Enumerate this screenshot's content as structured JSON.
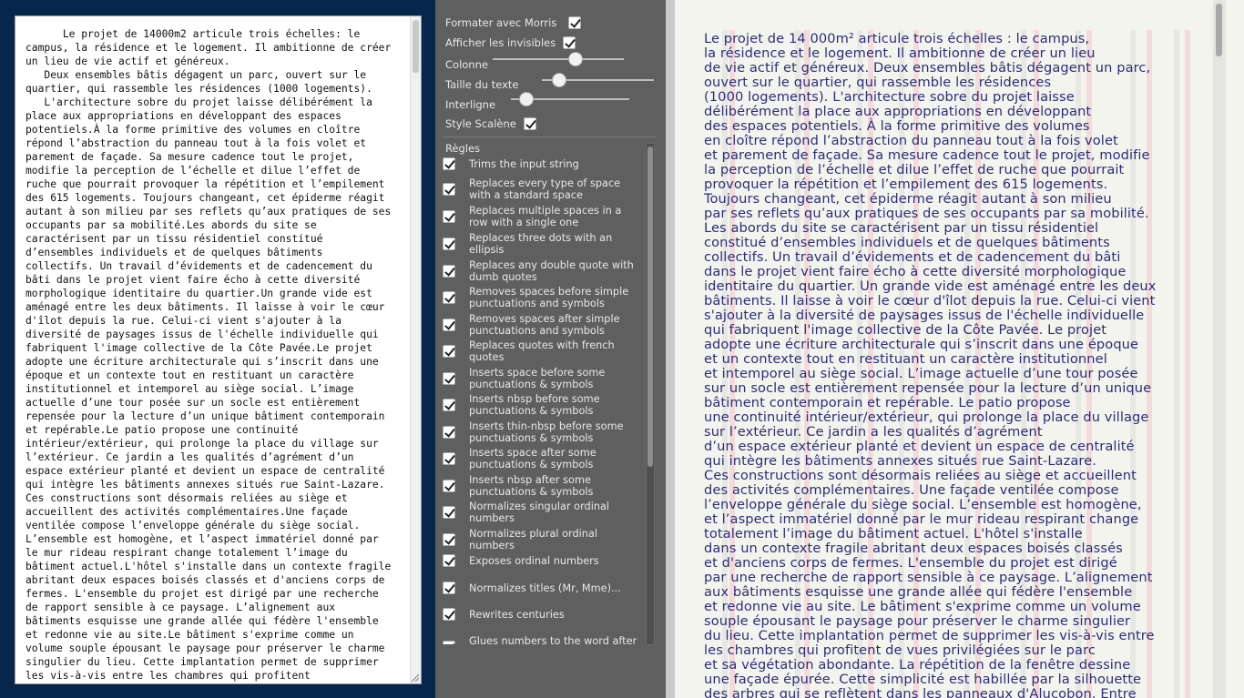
{
  "source_text": "      Le projet de 14000m2 articule trois échelles: le campus, la résidence et le logement. Il ambitionne de créer un lieu de vie actif et généreux.\n   Deux ensembles bâtis dégagent un parc, ouvert sur le quartier, qui rassemble les résidences (1000 logements).\n   L'architecture sobre du projet laisse délibérément la place aux appropriations en développant des espaces potentiels.À la forme primitive des volumes en cloître répond l’abstraction du panneau tout à la fois volet et parement de façade. Sa mesure cadence tout le projet, modifie la perception de l’échelle et dilue l’effet de ruche que pourrait provoquer la répétition et l’empilement des 615 logements. Toujours changeant, cet épiderme réagit autant à son milieu par ses reflets qu’aux pratiques de ses occupants par sa mobilité.Les abords du site se caractérisent par un tissu résidentiel constitué d’ensembles individuels et de quelques bâtiments collectifs. Un travail d’évidements et de cadencement du bâti dans le projet vient faire écho à cette diversité morphologique identitaire du quartier.Un grande vide est aménagé entre les deux bâtiments. Il laisse à voir le cœur d'îlot depuis la rue. Celui-ci vient s'ajouter à la diversité de paysages issus de l'échelle individuelle qui fabriquent l'image collective de la Côte Pavée.Le projet adopte une écriture architecturale qui s’inscrit dans une époque et un contexte tout en restituant un caractère institutionnel et intemporel au siège social. L’image actuelle d’une tour posée sur un socle est entièrement repensée pour la lecture d’un unique bâtiment contemporain et repérable.Le patio propose une continuité intérieur/extérieur, qui prolonge la place du village sur l’extérieur. Ce jardin a les qualités d’agrément d’un espace extérieur planté et devient un espace de centralité qui intègre les bâtiments annexes situés rue Saint-Lazare. Ces constructions sont désormais reliées au siège et accueillent des activités complémentaires.Une façade ventilée compose l’enveloppe générale du siège social. L’ensemble est homogène, et l’aspect immatériel donné par le mur rideau respirant change totalement l’image du bâtiment actuel.L'hôtel s'installe dans un contexte fragile abritant deux espaces boisés classés et d'anciens corps de fermes. L'ensemble du projet est dirigé par une recherche de rapport sensible à ce paysage. L’alignement aux bâtiments esquisse une grande allée qui fédère l'ensemble et redonne vie au site.Le bâtiment s'exprime comme un volume souple épousant le paysage pour préserver le charme singulier du lieu. Cette implantation permet de supprimer les vis-à-vis entre les chambres qui profitent",
  "options": {
    "morris_label": "Formater avec Morris",
    "morris_checked": true,
    "invisibles_label": "Afficher les invisibles",
    "invisibles_checked": true,
    "column_label": "Colonne",
    "column_value": 0.65,
    "text_size_label": "Taille du texte",
    "text_size_value": 0.1,
    "line_height_label": "Interligne",
    "line_height_value": 0.08,
    "scalene_label": "Style Scalène",
    "scalene_checked": true
  },
  "rules_title": "Règles",
  "rules": [
    {
      "label": "Trims the input string",
      "checked": true
    },
    {
      "label": "Replaces every type of space with a standard space",
      "checked": true
    },
    {
      "label": "Replaces multiple spaces in a row with a single one",
      "checked": true
    },
    {
      "label": "Replaces three dots with an ellipsis",
      "checked": true
    },
    {
      "label": "Replaces any double quote with dumb quotes",
      "checked": true
    },
    {
      "label": "Removes spaces before simple punctuations and symbols",
      "checked": true
    },
    {
      "label": "Removes spaces after simple punctuations and symbols",
      "checked": true
    },
    {
      "label": "Replaces quotes with french quotes",
      "checked": true
    },
    {
      "label": "Inserts space before some punctuations & symbols",
      "checked": true
    },
    {
      "label": "Inserts nbsp before some punctuations & symbols",
      "checked": true
    },
    {
      "label": "Inserts thin-nbsp before some punctuations & symbols",
      "checked": true
    },
    {
      "label": "Inserts space after some punctuations & symbols",
      "checked": true
    },
    {
      "label": "Inserts nbsp after some punctuations & symbols",
      "checked": true
    },
    {
      "label": "Normalizes singular ordinal numbers",
      "checked": true
    },
    {
      "label": "Normalizes plural ordinal numbers",
      "checked": true
    },
    {
      "label": "Exposes ordinal numbers",
      "checked": true
    },
    {
      "label": "Normalizes titles (Mr, Mme)...",
      "checked": true
    },
    {
      "label": "Rewrites centuries",
      "checked": true
    },
    {
      "label": "Glues numbers to the word after them",
      "checked": true
    }
  ],
  "preview_lines": [
    "Le projet de 14 000m² articule trois échelles : le campus,",
    "la résidence et le logement. Il ambitionne de créer un lieu",
    "de vie actif et généreux. Deux ensembles bâtis dégagent un parc,",
    "ouvert sur le quartier, qui rassemble les résidences",
    "(1000 logements). L'architecture sobre du projet laisse",
    "délibérément la place aux appropriations en développant",
    "des espaces potentiels. À la forme primitive des volumes",
    "en cloître répond l’abstraction du panneau tout à la fois volet",
    "et parement de façade. Sa mesure cadence tout le projet, modifie",
    "la perception de l’échelle et dilue l’effet de ruche que pourrait",
    "provoquer la répétition et l’empilement des 615 logements.",
    "Toujours changeant, cet épiderme réagit autant à son milieu",
    "par ses reflets qu’aux pratiques de ses occupants par sa mobilité.",
    "Les abords du site se caractérisent par un tissu résidentiel",
    "constitué d’ensembles individuels et de quelques bâtiments",
    "collectifs. Un travail d’évidements et de cadencement du bâti",
    "dans le projet vient faire écho à cette diversité morphologique",
    "identitaire du quartier. Un grande vide est aménagé entre les deux",
    "bâtiments. Il laisse à voir le cœur d'îlot depuis la rue. Celui-ci vient",
    "s'ajouter à la diversité de paysages issus de l'échelle individuelle",
    "qui fabriquent l'image collective de la Côte Pavée. Le projet",
    "adopte une écriture architecturale qui s’inscrit dans une époque",
    "et un contexte tout en restituant un caractère institutionnel",
    "et intemporel au siège social. L’image actuelle d’une tour posée",
    "sur un socle est entièrement repensée pour la lecture d’un unique",
    "bâtiment contemporain et repérable. Le patio propose",
    "une continuité intérieur/extérieur, qui prolonge la place du village",
    "sur l’extérieur. Ce jardin a les qualités d’agrément",
    "d’un espace extérieur planté et devient un espace de centralité",
    "qui intègre les bâtiments annexes situés rue Saint-Lazare.",
    "Ces constructions sont désormais reliées au siège et accueillent",
    "des activités complémentaires. Une façade ventilée compose",
    "l’enveloppe générale du siège social. L’ensemble est homogène,",
    "et l’aspect immatériel donné par le mur rideau respirant change",
    "totalement l’image du bâtiment actuel. L'hôtel s'installe",
    "dans un contexte fragile abritant deux espaces boisés classés",
    "et d'anciens corps de fermes. L'ensemble du projet est dirigé",
    "par une recherche de rapport sensible à ce paysage. L’alignement",
    "aux bâtiments esquisse une grande allée qui fédère l'ensemble",
    "et redonne vie au site. Le bâtiment s'exprime comme un volume",
    "souple épousant le paysage pour préserver le charme singulier",
    "du lieu. Cette implantation permet de supprimer les vis-à-vis entre",
    "les chambres qui profitent de vues privilégiées sur le parc",
    "et sa végétation abondante. La répétition de la fenêtre dessine",
    "une façade épurée. Cette simplicité est habillée par la silhouette",
    "des arbres qui se reflètent dans les panneaux d'Alucobon. Entre"
  ],
  "colors": {
    "left_bg": "#07264b",
    "panel_bg": "#5f5f5f",
    "preview_text": "#2d2d78",
    "invisible_gray": "#b8b8b8",
    "invisible_pink": "#f2c4cc"
  }
}
